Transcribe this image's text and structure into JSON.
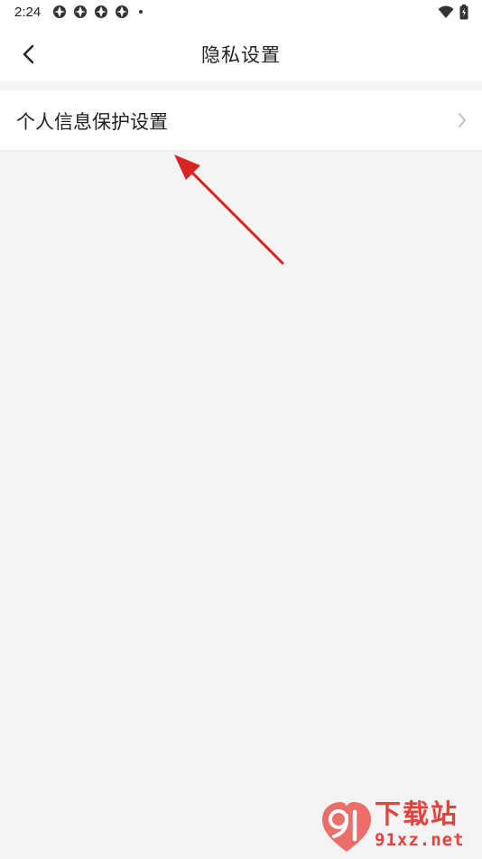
{
  "status_bar": {
    "time": "2:24",
    "notification_icons": [
      "app-icon",
      "app-icon",
      "app-icon",
      "app-icon"
    ],
    "right_icons": [
      "wifi-icon",
      "battery-icon"
    ]
  },
  "header": {
    "title": "隐私设置",
    "back_icon": "chevron-left-icon"
  },
  "settings_list": [
    {
      "label": "个人信息保护设置",
      "icon": "chevron-right-icon"
    }
  ],
  "annotation": {
    "color": "#d9231f"
  },
  "watermark": {
    "brand_text": "下载站",
    "url_text": "91xz.net",
    "color": "#e8413b"
  },
  "colors": {
    "background": "#f4f4f4",
    "surface": "#ffffff",
    "text": "#222222",
    "chevron": "#bbbbbb"
  }
}
